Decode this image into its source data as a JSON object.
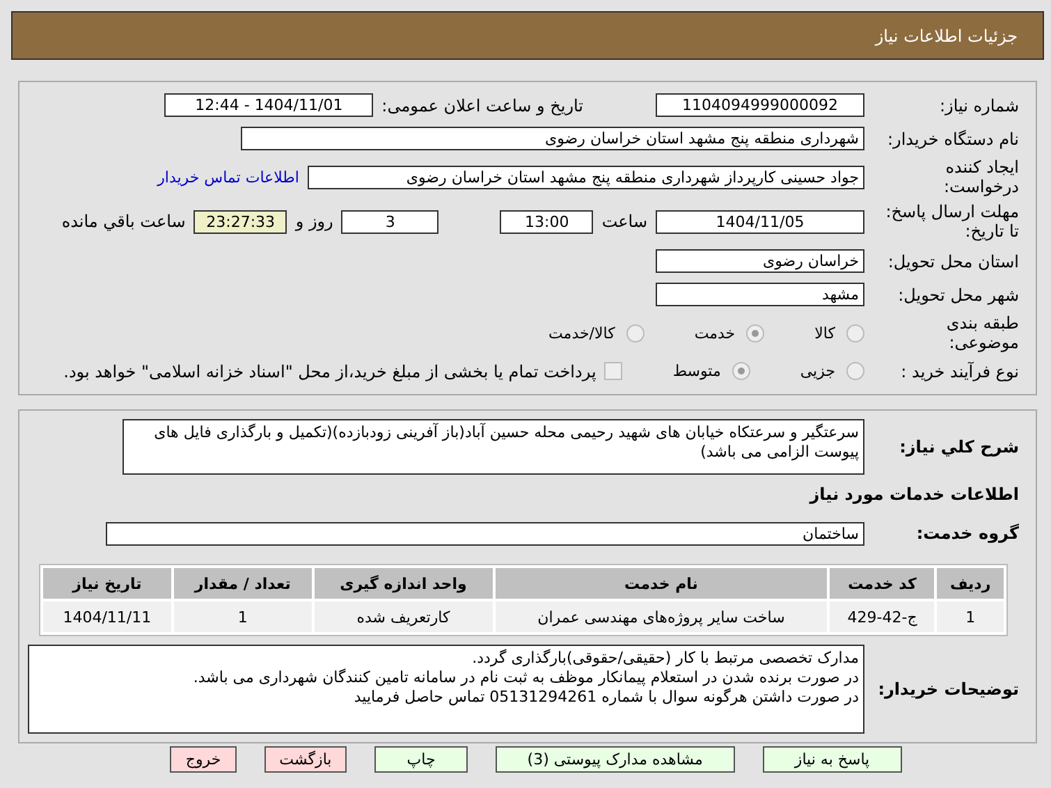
{
  "window": {
    "title": "جزئیات اطلاعات نیاز"
  },
  "need_number": {
    "label": "شماره نیاز:",
    "value": "1104094999000092"
  },
  "announce": {
    "label": "تاریخ و ساعت اعلان عمومی:",
    "value": "1404/11/01 - 12:44"
  },
  "buyer": {
    "label": "نام دستگاه خریدار:",
    "value": "شهرداری منطقه پنج مشهد استان خراسان رضوی"
  },
  "creator": {
    "label": "ایجاد کننده درخواست:",
    "value": "جواد حسینی کارپرداز شهرداری منطقه پنج مشهد استان خراسان رضوی",
    "link": "اطلاعات تماس خریدار"
  },
  "deadline": {
    "label": "مهلت ارسال پاسخ: تا تاریخ:",
    "date": "1404/11/05",
    "time_label": "ساعت",
    "time": "13:00",
    "days": "3",
    "days_label": "روز و",
    "remaining": "23:27:33",
    "remaining_label": "ساعت باقي مانده"
  },
  "province": {
    "label": "استان محل تحویل:",
    "value": "خراسان رضوی"
  },
  "city": {
    "label": "شهر محل تحویل:",
    "value": "مشهد"
  },
  "category": {
    "label": "طبقه بندی موضوعی:",
    "options": [
      {
        "label": "کالا",
        "selected": false
      },
      {
        "label": "خدمت",
        "selected": true
      },
      {
        "label": "کالا/خدمت",
        "selected": false
      }
    ]
  },
  "purchase_type": {
    "label": "نوع فرآیند خرید :",
    "options": [
      {
        "label": "جزیی",
        "selected": false
      },
      {
        "label": "متوسط",
        "selected": true
      }
    ],
    "payment": {
      "checked": false,
      "text": "پرداخت تمام یا بخشی از مبلغ خرید،از محل \"اسناد خزانه اسلامی\" خواهد بود."
    }
  },
  "summary": {
    "label": "شرح کلي نیاز:",
    "value": "سرعتگیر و سرعتکاه خیابان های شهید رحیمی محله حسین آباد(باز آفرینی زودبازده)(تکمیل و بارگذاری فایل های پیوست الزامی می باشد)"
  },
  "services_heading": "اطلاعات خدمات مورد نیاز",
  "service_group": {
    "label": "گروه خدمت:",
    "value": "ساختمان"
  },
  "table": {
    "columns": [
      "ردیف",
      "کد خدمت",
      "نام خدمت",
      "واحد اندازه گیری",
      "تعداد / مقدار",
      "تاریخ نیاز"
    ],
    "rows": [
      [
        "1",
        "ج-42-429",
        "ساخت سایر پروژه‌های مهندسی عمران",
        "کارتعریف شده",
        "1",
        "1404/11/11"
      ]
    ]
  },
  "buyer_notes": {
    "label": "توضیحات خریدار:",
    "lines": [
      "مدارک تخصصی مرتبط با کار (حقیقی/حقوقی)بارگذاری گردد.",
      "در صورت برنده شدن در استعلام پیمانکار موظف به ثبت نام در سامانه تامین کنندگان شهرداری می باشد.",
      "در صورت داشتن هرگونه سوال  با شماره 05131294261 تماس حاصل فرمایید"
    ]
  },
  "buttons": [
    {
      "label": "پاسخ به نیاز",
      "kind": "action"
    },
    {
      "label": "مشاهده مدارک پیوستی (3)",
      "kind": "action"
    },
    {
      "label": "چاپ",
      "kind": "action"
    },
    {
      "label": "بازگشت",
      "kind": "exit"
    },
    {
      "label": "خروج",
      "kind": "exit"
    }
  ]
}
